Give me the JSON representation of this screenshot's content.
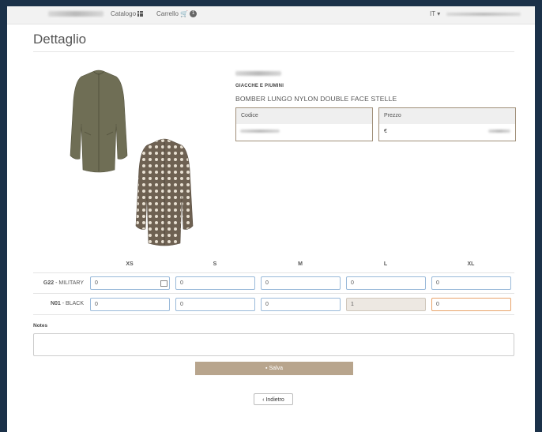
{
  "navbar": {
    "catalog_label": "Catalogo",
    "cart_label": "Carrello",
    "cart_count": "1",
    "language": "IT ▾"
  },
  "page": {
    "title": "Dettaglio"
  },
  "product": {
    "category": "GIACCHE E PIUMINI",
    "name": "BOMBER LUNGO NYLON DOUBLE FACE STELLE",
    "code_label": "Codice",
    "price_label": "Prezzo",
    "price_currency": "€"
  },
  "sizes": [
    "XS",
    "S",
    "M",
    "L",
    "XL"
  ],
  "rows": [
    {
      "code": "G22",
      "color": "MILITARY",
      "values": [
        "0",
        "0",
        "0",
        "0",
        "0"
      ]
    },
    {
      "code": "N01",
      "color": "BLACK",
      "values": [
        "0",
        "0",
        "0",
        "1",
        "0"
      ]
    }
  ],
  "notes": {
    "label": "Notes",
    "value": ""
  },
  "actions": {
    "save_label": "Salva",
    "back_label": "Indietro"
  },
  "colors": {
    "accent": "#b8a58d",
    "background": "#1b3149",
    "input_border": "#99b9d9"
  }
}
